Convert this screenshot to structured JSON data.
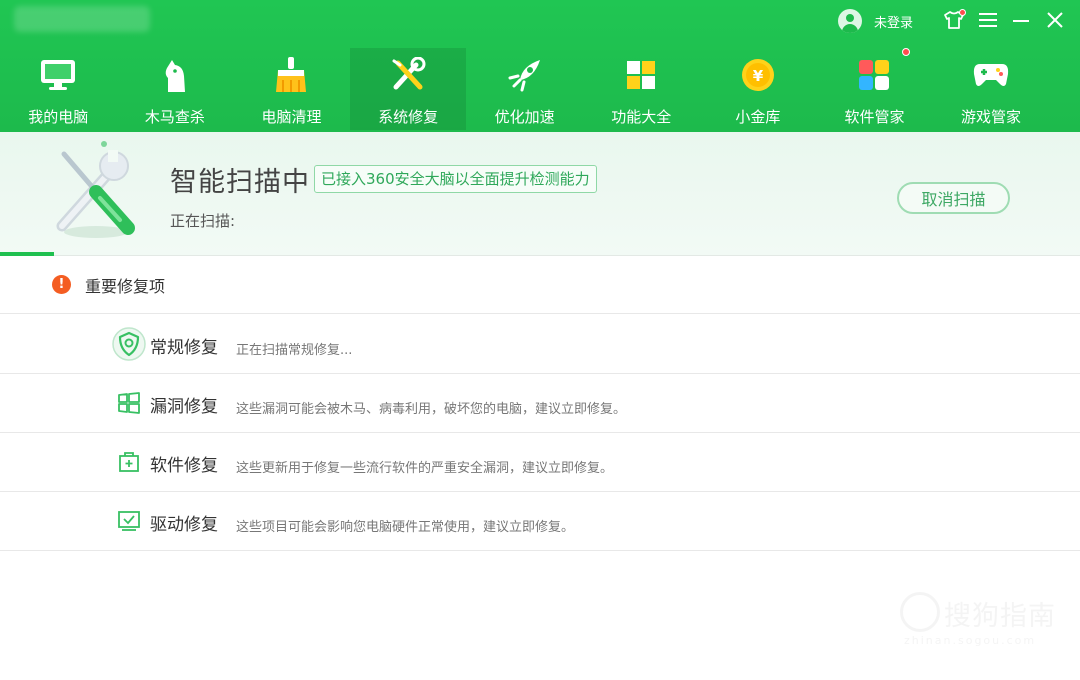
{
  "window": {
    "user_label": "未登录",
    "colors": {
      "header": "#1dba4c",
      "accent": "#1fc04f",
      "warning": "#f45d22",
      "badge_dot": "#ff4d4f"
    }
  },
  "nav": {
    "items": [
      {
        "label": "我的电脑",
        "icon": "monitor-icon"
      },
      {
        "label": "木马查杀",
        "icon": "horse-icon"
      },
      {
        "label": "电脑清理",
        "icon": "broom-icon"
      },
      {
        "label": "系统修复",
        "icon": "wrench-screwdriver-icon",
        "active": true
      },
      {
        "label": "优化加速",
        "icon": "rocket-icon"
      },
      {
        "label": "功能大全",
        "icon": "grid-icon"
      },
      {
        "label": "小金库",
        "icon": "coin-icon"
      },
      {
        "label": "软件管家",
        "icon": "apps-icon"
      },
      {
        "label": "游戏管家",
        "icon": "gamepad-icon"
      }
    ]
  },
  "scan": {
    "title": "智能扫描中",
    "badge": "已接入360安全大脑以全面提升检测能力",
    "status": "正在扫描:",
    "cancel_label": "取消扫描",
    "progress": 0.05
  },
  "section": {
    "title": "重要修复项",
    "warning_glyph": "!"
  },
  "rows": [
    {
      "title": "常规修复",
      "desc": "正在扫描常规修复...",
      "icon": "shield-icon"
    },
    {
      "title": "漏洞修复",
      "desc": "这些漏洞可能会被木马、病毒利用，破坏您的电脑，建议立即修复。",
      "icon": "windows-icon"
    },
    {
      "title": "软件修复",
      "desc": "这些更新用于修复一些流行软件的严重安全漏洞，建议立即修复。",
      "icon": "software-box-icon"
    },
    {
      "title": "驱动修复",
      "desc": "这些项目可能会影响您电脑硬件正常使用，建议立即修复。",
      "icon": "driver-check-icon"
    }
  ],
  "watermark": {
    "text": "搜狗指南",
    "sub": "zhinan.sogou.com"
  }
}
